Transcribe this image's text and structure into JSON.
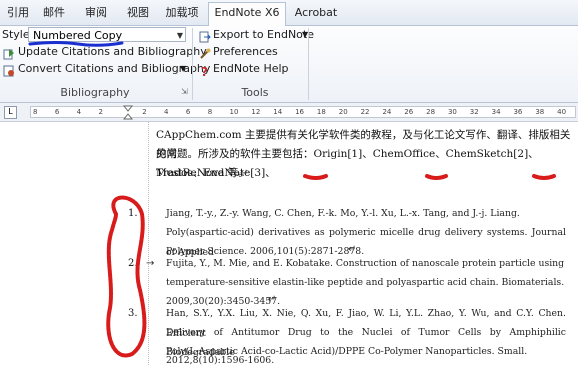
{
  "tabs": [
    {
      "label": "引用"
    },
    {
      "label": "邮件"
    },
    {
      "label": "审阅"
    },
    {
      "label": "视图"
    },
    {
      "label": "加载项"
    },
    {
      "label": "EndNote X6"
    },
    {
      "label": "Acrobat"
    }
  ],
  "ribbon": {
    "style_label": "Style:",
    "style_value": "Numbered Copy",
    "update_citations": "Update Citations and Bibliography",
    "convert_citations": "Convert Citations and Bibliography",
    "bibliography_group": "Bibliography",
    "export_label": "Export to EndNote",
    "preferences_label": "Preferences",
    "help_label": "EndNote Help",
    "tools_group": "Tools"
  },
  "ruler": {
    "numbers": [
      "8",
      "6",
      "4",
      "2",
      "",
      "2",
      "4",
      "6",
      "8",
      "10",
      "12",
      "14",
      "16",
      "18",
      "20",
      "22",
      "24",
      "26",
      "28",
      "30",
      "32",
      "34",
      "36",
      "38",
      "40"
    ]
  },
  "document": {
    "intro_line1": "CAppChem.com 主要提供有关化学软件类的教程，及与化工论文写作、翻译、排版相关的常",
    "intro_line2": "见问题。所涉及的软件主要包括：Origin[1]、ChemOffice、ChemSketch[2]、Trados、EndNote[3]、",
    "intro_line3": "MestReNova 等。",
    "references": [
      {
        "number": "1.",
        "line1": "Jiang, T.-y., Z.-y. Wang, C. Chen, F.-k. Mo, Y.-l. Xu, L.-x. Tang, and J.-j. Liang.",
        "line2": "Poly(aspartic-acid) derivatives as polymeric micelle drug delivery systems. Journal of Applied",
        "line3": "Polymer Science. 2006,101(5):2871-2878."
      },
      {
        "number": "2.",
        "line1": "Fujita, Y., M. Mie, and E. Kobatake. Construction of nanoscale protein particle using",
        "line2": "temperature-sensitive elastin-like peptide and polyaspartic acid chain. Biomaterials.",
        "line3": "2009,30(20):3450-3457."
      },
      {
        "number": "3.",
        "line1": "Han, S.Y., Y.X. Liu, X. Nie, Q. Xu, F. Jiao, W. Li, Y.L. Zhao, Y. Wu, and C.Y. Chen. Efficient",
        "line2": "Delivery of Antitumor Drug to the Nuclei of Tumor Cells by Amphiphilic Biodegradable",
        "line3": "Poly(L-Aspartic Acid-co-Lactic Acid)/DPPE Co-Polymer Nanoparticles. Small.",
        "line4": "2012,8(10):1596-1606."
      }
    ]
  },
  "colors": {
    "annotation_red": "#d81c1c",
    "annotation_blue": "#1a2fd0",
    "ribbon_border": "#b6c3d6"
  }
}
